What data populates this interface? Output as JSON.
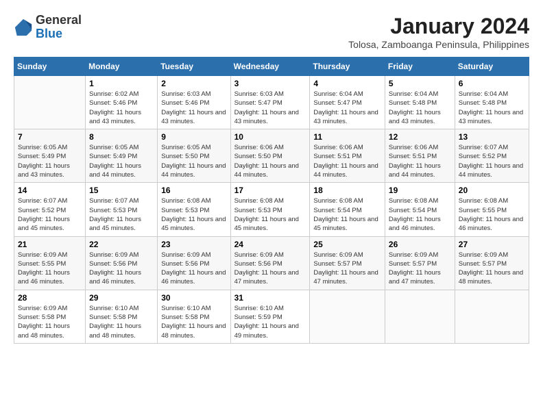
{
  "logo": {
    "general": "General",
    "blue": "Blue"
  },
  "title": "January 2024",
  "subtitle": "Tolosa, Zamboanga Peninsula, Philippines",
  "days_header": [
    "Sunday",
    "Monday",
    "Tuesday",
    "Wednesday",
    "Thursday",
    "Friday",
    "Saturday"
  ],
  "weeks": [
    [
      {
        "day": "",
        "sunrise": "",
        "sunset": "",
        "daylight": ""
      },
      {
        "day": "1",
        "sunrise": "Sunrise: 6:02 AM",
        "sunset": "Sunset: 5:46 PM",
        "daylight": "Daylight: 11 hours and 43 minutes."
      },
      {
        "day": "2",
        "sunrise": "Sunrise: 6:03 AM",
        "sunset": "Sunset: 5:46 PM",
        "daylight": "Daylight: 11 hours and 43 minutes."
      },
      {
        "day": "3",
        "sunrise": "Sunrise: 6:03 AM",
        "sunset": "Sunset: 5:47 PM",
        "daylight": "Daylight: 11 hours and 43 minutes."
      },
      {
        "day": "4",
        "sunrise": "Sunrise: 6:04 AM",
        "sunset": "Sunset: 5:47 PM",
        "daylight": "Daylight: 11 hours and 43 minutes."
      },
      {
        "day": "5",
        "sunrise": "Sunrise: 6:04 AM",
        "sunset": "Sunset: 5:48 PM",
        "daylight": "Daylight: 11 hours and 43 minutes."
      },
      {
        "day": "6",
        "sunrise": "Sunrise: 6:04 AM",
        "sunset": "Sunset: 5:48 PM",
        "daylight": "Daylight: 11 hours and 43 minutes."
      }
    ],
    [
      {
        "day": "7",
        "sunrise": "Sunrise: 6:05 AM",
        "sunset": "Sunset: 5:49 PM",
        "daylight": "Daylight: 11 hours and 43 minutes."
      },
      {
        "day": "8",
        "sunrise": "Sunrise: 6:05 AM",
        "sunset": "Sunset: 5:49 PM",
        "daylight": "Daylight: 11 hours and 44 minutes."
      },
      {
        "day": "9",
        "sunrise": "Sunrise: 6:05 AM",
        "sunset": "Sunset: 5:50 PM",
        "daylight": "Daylight: 11 hours and 44 minutes."
      },
      {
        "day": "10",
        "sunrise": "Sunrise: 6:06 AM",
        "sunset": "Sunset: 5:50 PM",
        "daylight": "Daylight: 11 hours and 44 minutes."
      },
      {
        "day": "11",
        "sunrise": "Sunrise: 6:06 AM",
        "sunset": "Sunset: 5:51 PM",
        "daylight": "Daylight: 11 hours and 44 minutes."
      },
      {
        "day": "12",
        "sunrise": "Sunrise: 6:06 AM",
        "sunset": "Sunset: 5:51 PM",
        "daylight": "Daylight: 11 hours and 44 minutes."
      },
      {
        "day": "13",
        "sunrise": "Sunrise: 6:07 AM",
        "sunset": "Sunset: 5:52 PM",
        "daylight": "Daylight: 11 hours and 44 minutes."
      }
    ],
    [
      {
        "day": "14",
        "sunrise": "Sunrise: 6:07 AM",
        "sunset": "Sunset: 5:52 PM",
        "daylight": "Daylight: 11 hours and 45 minutes."
      },
      {
        "day": "15",
        "sunrise": "Sunrise: 6:07 AM",
        "sunset": "Sunset: 5:53 PM",
        "daylight": "Daylight: 11 hours and 45 minutes."
      },
      {
        "day": "16",
        "sunrise": "Sunrise: 6:08 AM",
        "sunset": "Sunset: 5:53 PM",
        "daylight": "Daylight: 11 hours and 45 minutes."
      },
      {
        "day": "17",
        "sunrise": "Sunrise: 6:08 AM",
        "sunset": "Sunset: 5:53 PM",
        "daylight": "Daylight: 11 hours and 45 minutes."
      },
      {
        "day": "18",
        "sunrise": "Sunrise: 6:08 AM",
        "sunset": "Sunset: 5:54 PM",
        "daylight": "Daylight: 11 hours and 45 minutes."
      },
      {
        "day": "19",
        "sunrise": "Sunrise: 6:08 AM",
        "sunset": "Sunset: 5:54 PM",
        "daylight": "Daylight: 11 hours and 46 minutes."
      },
      {
        "day": "20",
        "sunrise": "Sunrise: 6:08 AM",
        "sunset": "Sunset: 5:55 PM",
        "daylight": "Daylight: 11 hours and 46 minutes."
      }
    ],
    [
      {
        "day": "21",
        "sunrise": "Sunrise: 6:09 AM",
        "sunset": "Sunset: 5:55 PM",
        "daylight": "Daylight: 11 hours and 46 minutes."
      },
      {
        "day": "22",
        "sunrise": "Sunrise: 6:09 AM",
        "sunset": "Sunset: 5:56 PM",
        "daylight": "Daylight: 11 hours and 46 minutes."
      },
      {
        "day": "23",
        "sunrise": "Sunrise: 6:09 AM",
        "sunset": "Sunset: 5:56 PM",
        "daylight": "Daylight: 11 hours and 46 minutes."
      },
      {
        "day": "24",
        "sunrise": "Sunrise: 6:09 AM",
        "sunset": "Sunset: 5:56 PM",
        "daylight": "Daylight: 11 hours and 47 minutes."
      },
      {
        "day": "25",
        "sunrise": "Sunrise: 6:09 AM",
        "sunset": "Sunset: 5:57 PM",
        "daylight": "Daylight: 11 hours and 47 minutes."
      },
      {
        "day": "26",
        "sunrise": "Sunrise: 6:09 AM",
        "sunset": "Sunset: 5:57 PM",
        "daylight": "Daylight: 11 hours and 47 minutes."
      },
      {
        "day": "27",
        "sunrise": "Sunrise: 6:09 AM",
        "sunset": "Sunset: 5:57 PM",
        "daylight": "Daylight: 11 hours and 48 minutes."
      }
    ],
    [
      {
        "day": "28",
        "sunrise": "Sunrise: 6:09 AM",
        "sunset": "Sunset: 5:58 PM",
        "daylight": "Daylight: 11 hours and 48 minutes."
      },
      {
        "day": "29",
        "sunrise": "Sunrise: 6:10 AM",
        "sunset": "Sunset: 5:58 PM",
        "daylight": "Daylight: 11 hours and 48 minutes."
      },
      {
        "day": "30",
        "sunrise": "Sunrise: 6:10 AM",
        "sunset": "Sunset: 5:58 PM",
        "daylight": "Daylight: 11 hours and 48 minutes."
      },
      {
        "day": "31",
        "sunrise": "Sunrise: 6:10 AM",
        "sunset": "Sunset: 5:59 PM",
        "daylight": "Daylight: 11 hours and 49 minutes."
      },
      {
        "day": "",
        "sunrise": "",
        "sunset": "",
        "daylight": ""
      },
      {
        "day": "",
        "sunrise": "",
        "sunset": "",
        "daylight": ""
      },
      {
        "day": "",
        "sunrise": "",
        "sunset": "",
        "daylight": ""
      }
    ]
  ]
}
